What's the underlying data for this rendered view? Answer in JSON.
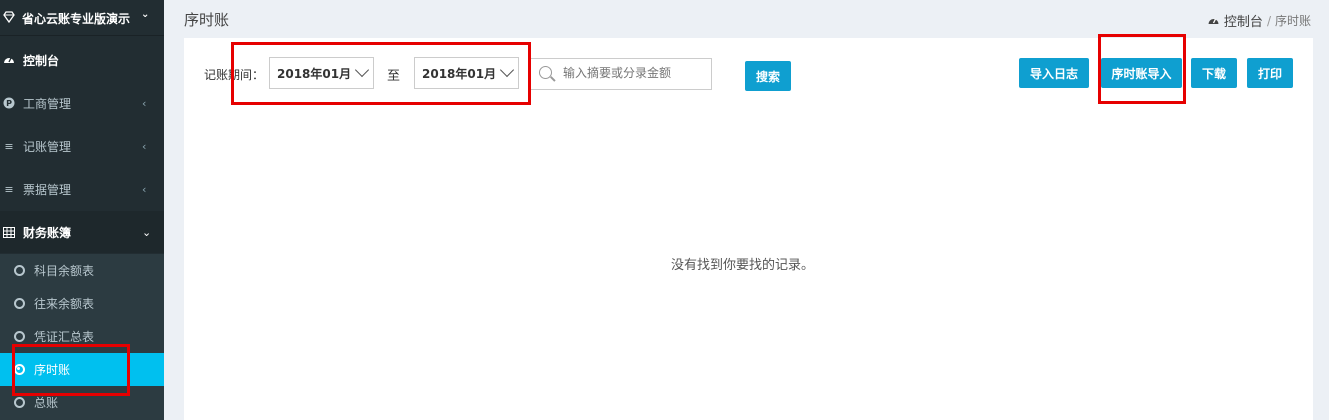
{
  "sidebar": {
    "brand": "省心云账专业版演示",
    "items": [
      {
        "label": "控制台"
      },
      {
        "label": "工商管理"
      },
      {
        "label": "记账管理"
      },
      {
        "label": "票据管理"
      },
      {
        "label": "财务账簿"
      }
    ],
    "sub_items": [
      {
        "label": "科目余额表"
      },
      {
        "label": "往来余额表"
      },
      {
        "label": "凭证汇总表"
      },
      {
        "label": "序时账"
      },
      {
        "label": "总账"
      }
    ]
  },
  "header": {
    "title": "序时账",
    "breadcrumb_home": "控制台",
    "breadcrumb_sep": "/",
    "breadcrumb_current": "序时账"
  },
  "filter": {
    "date_label": "记账期间：",
    "start_value": "2018年01月",
    "to_label": "至",
    "end_value": "2018年01月",
    "search_placeholder": "输入摘要或分录金额",
    "search_button": "搜索"
  },
  "actions": {
    "import_log": "导入日志",
    "import_journal": "序时账导入",
    "download": "下载",
    "print": "打印"
  },
  "table": {
    "empty_message": "没有找到你要找的记录。"
  },
  "colors": {
    "sidebar_bg": "#222d32",
    "active_item": "#00c0ef",
    "button": "#0f9fd0",
    "highlight_box": "#e60000"
  }
}
